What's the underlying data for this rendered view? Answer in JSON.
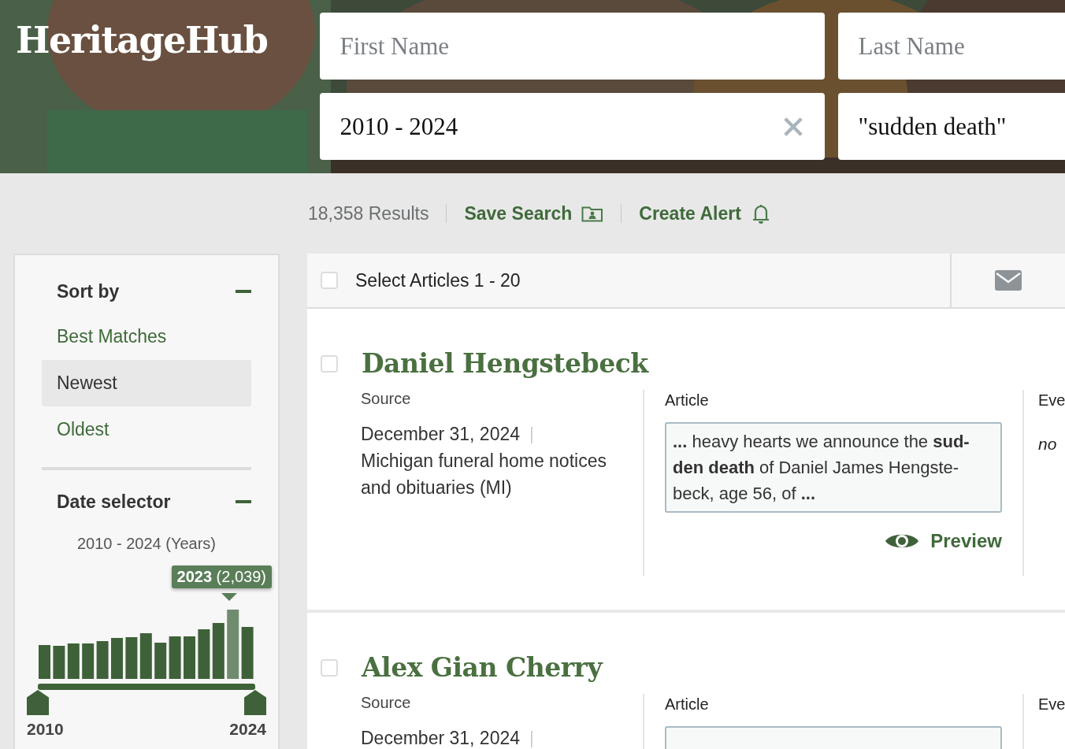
{
  "header": {
    "logo": "HeritageHub",
    "fields": [
      {
        "kind": "text",
        "placeholder": "First Name",
        "clearable": false
      },
      {
        "kind": "text",
        "placeholder": "Last Name",
        "clearable": false
      },
      {
        "kind": "text",
        "value": "2010 - 2024",
        "clearable": true
      },
      {
        "kind": "text",
        "value": "\"sudden death\"",
        "clearable": false
      }
    ]
  },
  "toolbar": {
    "results": "18,358 Results",
    "save_search": "Save Search",
    "create_alert": "Create Alert"
  },
  "sidebar": {
    "sort": {
      "title": "Sort by",
      "expanded": true,
      "items": [
        {
          "label": "Best Matches",
          "selected": false
        },
        {
          "label": "Newest",
          "selected": true
        },
        {
          "label": "Oldest",
          "selected": false
        }
      ]
    },
    "date": {
      "title": "Date selector",
      "expanded": true,
      "range": "2010 - 2024 (Years)",
      "tooltip": "2023",
      "tooltip_count": "(2,039)",
      "bars": [
        {
          "selected": false
        },
        {
          "selected": false
        },
        {
          "selected": false
        },
        {
          "selected": false
        },
        {
          "selected": false
        },
        {
          "selected": false
        },
        {
          "selected": false
        },
        {
          "selected": false
        },
        {
          "selected": false
        },
        {
          "selected": false
        },
        {
          "selected": false
        },
        {
          "selected": false
        },
        {
          "selected": false
        },
        {
          "selected": true
        },
        {
          "selected": false
        }
      ],
      "handles": [
        {
          "label": "2010",
          "level": 0
        },
        {
          "label": "2024",
          "level": 1
        }
      ]
    }
  },
  "results_header": {
    "select_label": "Select Articles 1 - 20",
    "checked": false
  },
  "results": [
    {
      "name": "Daniel Hengstebeck",
      "checked": false,
      "source_label": "Source",
      "date": "December 31, 2024",
      "separator": "|",
      "source": "Michigan funeral home notices and obituaries (MI)",
      "article_label": "Article",
      "snippet": "**...** heavy hearts we announce the **sud-den death** of Daniel James Hengste-beck, age 56, of **...**",
      "preview": "Preview",
      "event_label": "Eve",
      "event": "no"
    },
    {
      "name": "Alex Gian Cherry",
      "checked": false,
      "source_label": "Source",
      "date": "December 31, 2024",
      "separator": "|",
      "article_label": "Article",
      "event_label": "Eve"
    }
  ]
}
